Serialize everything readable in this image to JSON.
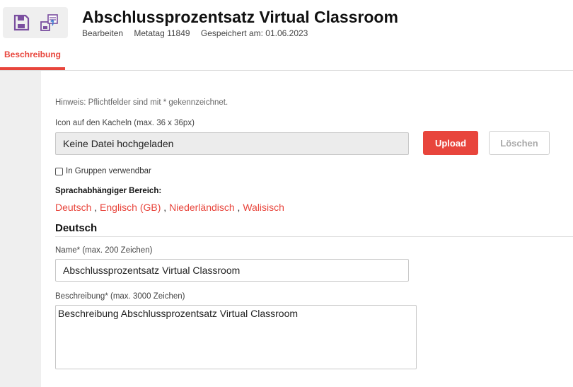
{
  "header": {
    "title": "Abschlussprozentsatz Virtual Classroom",
    "mode": "Bearbeiten",
    "metatag": "Metatag 11849",
    "saved": "Gespeichert am: 01.06.2023"
  },
  "tabs": {
    "description": "Beschreibung"
  },
  "form": {
    "hint": "Hinweis: Pflichtfelder sind mit * gekennzeichnet.",
    "icon_label": "Icon auf den Kacheln (max. 36 x 36px)",
    "file_status": "Keine Datei hochgeladen",
    "upload_label": "Upload",
    "delete_label": "Löschen",
    "groups_checkbox_label": "In Gruppen verwendbar",
    "groups_checked": false,
    "lang_section_label": "Sprachabhängiger Bereich:",
    "languages": [
      "Deutsch",
      "Englisch (GB)",
      "Niederländisch",
      "Walisisch"
    ],
    "current_language": "Deutsch",
    "name_label": "Name* (max. 200 Zeichen)",
    "name_value": "Abschlussprozentsatz Virtual Classroom",
    "desc_label": "Beschreibung* (max. 3000 Zeichen)",
    "desc_value": "Beschreibung Abschlussprozentsatz Virtual Classroom"
  },
  "colors": {
    "accent": "#e8453c",
    "toolbar_icon": "#7b4fa0"
  },
  "icons": {
    "save": "floppy-disk-icon",
    "save_copy": "save-copy-icon"
  }
}
